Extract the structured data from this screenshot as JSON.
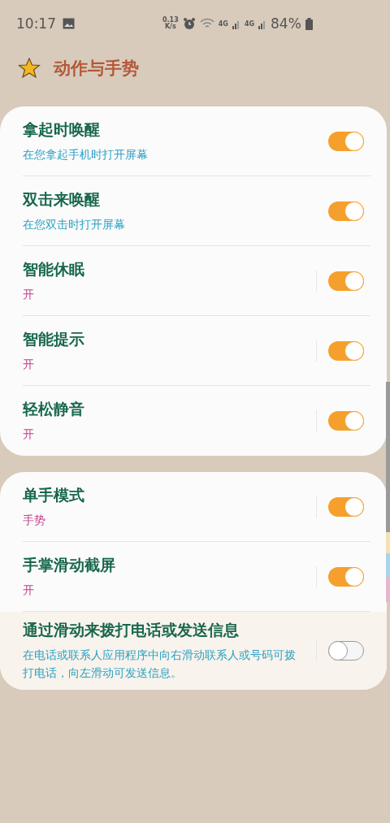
{
  "status_bar": {
    "time": "10:17",
    "net_speed": "0.13",
    "net_unit": "K/s",
    "network_1": "4G",
    "network_2": "4G",
    "battery": "84%"
  },
  "header": {
    "title": "动作与手势"
  },
  "groups": [
    {
      "items": [
        {
          "title": "拿起时唤醒",
          "subtitle": "在您拿起手机时打开屏幕",
          "kind": "description",
          "split": false,
          "on": true,
          "highlighted": false
        },
        {
          "title": "双击来唤醒",
          "subtitle": "在您双击时打开屏幕",
          "kind": "description",
          "split": false,
          "on": true,
          "highlighted": false
        },
        {
          "title": "智能休眠",
          "subtitle": "开",
          "kind": "status",
          "split": true,
          "on": true,
          "highlighted": false
        },
        {
          "title": "智能提示",
          "subtitle": "开",
          "kind": "status",
          "split": true,
          "on": true,
          "highlighted": false
        },
        {
          "title": "轻松静音",
          "subtitle": "开",
          "kind": "status",
          "split": true,
          "on": true,
          "highlighted": false
        }
      ]
    },
    {
      "items": [
        {
          "title": "单手模式",
          "subtitle": "手势",
          "kind": "status",
          "split": true,
          "on": true,
          "highlighted": false
        },
        {
          "title": "手掌滑动截屏",
          "subtitle": "开",
          "kind": "status",
          "split": true,
          "on": true,
          "highlighted": false
        },
        {
          "title": "通过滑动来拨打电话或发送信息",
          "subtitle": "在电话或联系人应用程序中向右滑动联系人或号码可拨打电话，向左滑动可发送信息。",
          "kind": "description",
          "split": true,
          "on": false,
          "highlighted": true
        }
      ]
    }
  ]
}
